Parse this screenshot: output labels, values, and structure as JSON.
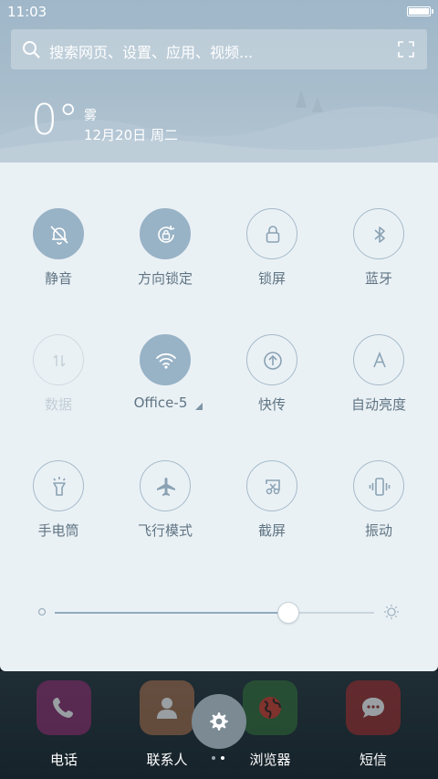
{
  "status": {
    "time": "11:03"
  },
  "search": {
    "placeholder": "搜索网页、设置、应用、视频..."
  },
  "weather": {
    "temperature": "0°",
    "condition": "雾",
    "date": "12月20日 周二"
  },
  "toggles": [
    {
      "label": "静音",
      "icon": "bell-off-icon",
      "state": "on"
    },
    {
      "label": "方向锁定",
      "icon": "rotation-lock-icon",
      "state": "on"
    },
    {
      "label": "锁屏",
      "icon": "lock-icon",
      "state": "off"
    },
    {
      "label": "蓝牙",
      "icon": "bluetooth-icon",
      "state": "off"
    },
    {
      "label": "数据",
      "icon": "mobile-data-icon",
      "state": "disabled"
    },
    {
      "label": "Office-5",
      "icon": "wifi-icon",
      "state": "on"
    },
    {
      "label": "快传",
      "icon": "upload-icon",
      "state": "off"
    },
    {
      "label": "自动亮度",
      "icon": "auto-brightness-icon",
      "state": "off"
    },
    {
      "label": "手电筒",
      "icon": "flashlight-icon",
      "state": "off"
    },
    {
      "label": "飞行模式",
      "icon": "airplane-icon",
      "state": "off"
    },
    {
      "label": "截屏",
      "icon": "screenshot-icon",
      "state": "off"
    },
    {
      "label": "振动",
      "icon": "vibrate-icon",
      "state": "off"
    }
  ],
  "brightness": {
    "level": 0.73
  },
  "dock": [
    {
      "label": "电话",
      "icon": "phone-icon",
      "color": "#8a2a6c"
    },
    {
      "label": "联系人",
      "icon": "contacts-icon",
      "color": "#a06a48"
    },
    {
      "label": "浏览器",
      "icon": "browser-icon",
      "color": "#2f6b35"
    },
    {
      "label": "短信",
      "icon": "message-icon",
      "color": "#9a2a2a"
    }
  ],
  "colors": {
    "accent": "#98b2c6",
    "panel": "#eaf1f5",
    "label": "#5f7483"
  }
}
